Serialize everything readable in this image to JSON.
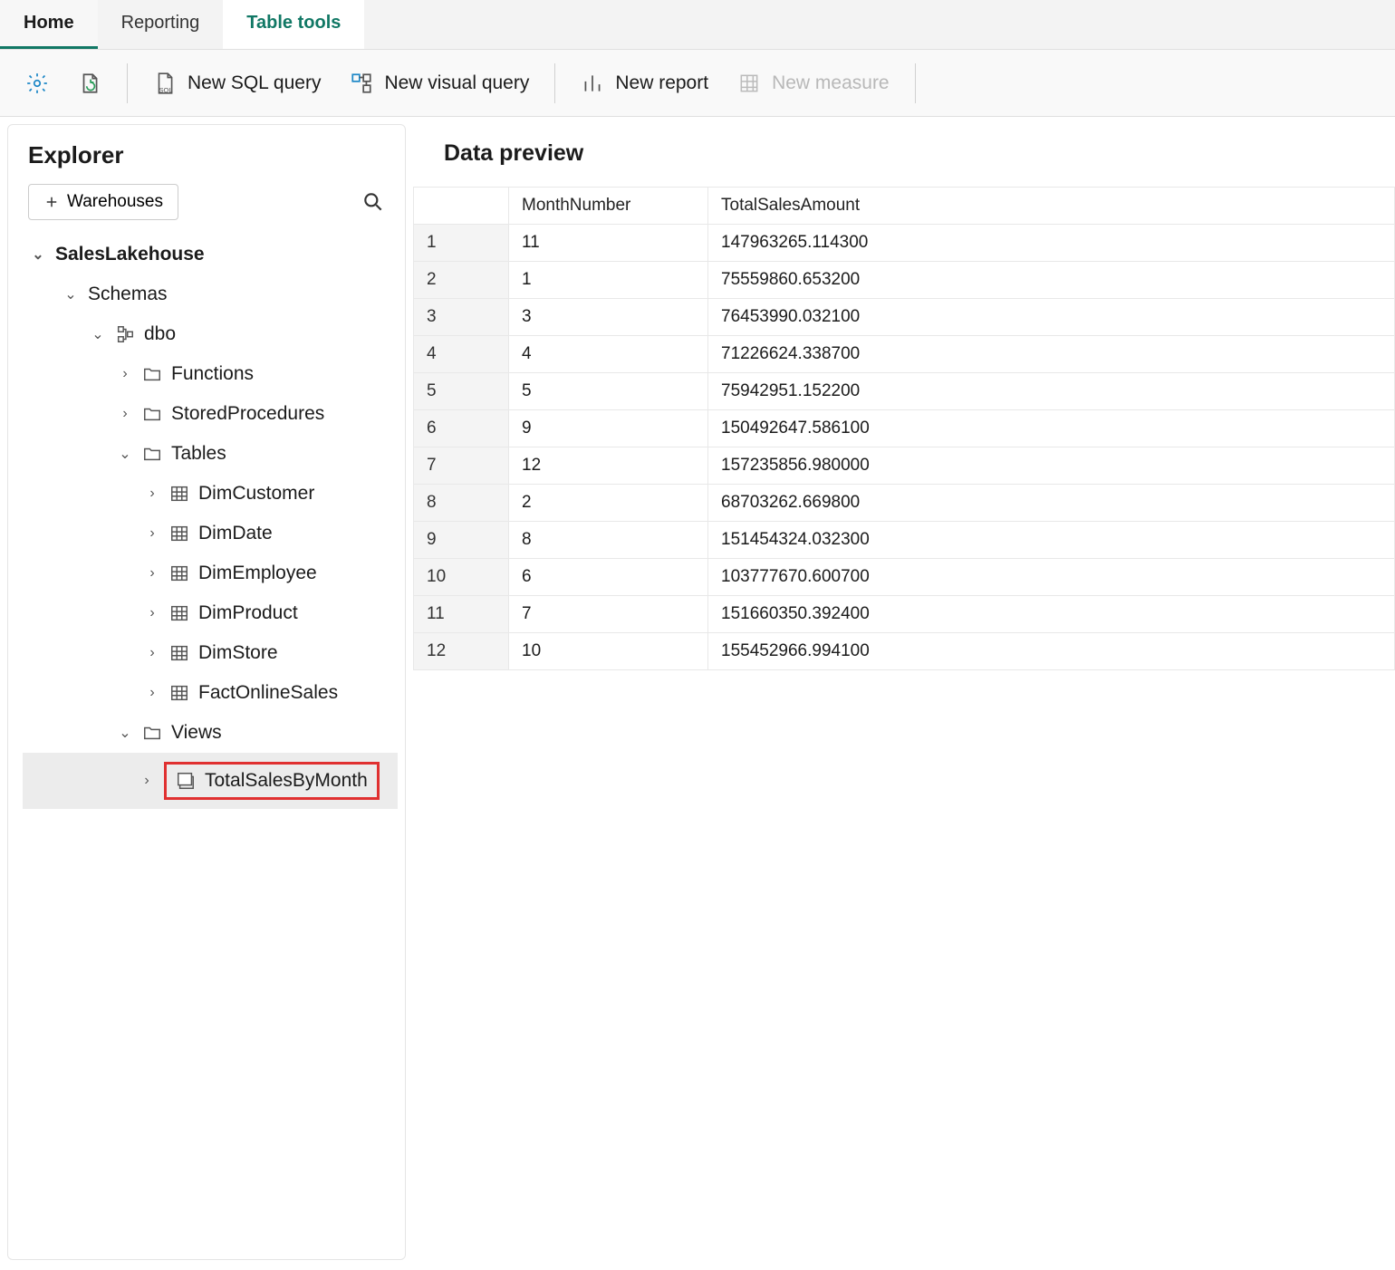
{
  "tabs": {
    "home": "Home",
    "reporting": "Reporting",
    "tableTools": "Table tools"
  },
  "toolbar": {
    "newSql": "New SQL query",
    "newVisual": "New visual query",
    "newReport": "New report",
    "newMeasure": "New measure"
  },
  "explorer": {
    "title": "Explorer",
    "warehousesBtn": "Warehouses",
    "root": "SalesLakehouse",
    "schemas": "Schemas",
    "dbo": "dbo",
    "functions": "Functions",
    "storedProcedures": "StoredProcedures",
    "tablesLabel": "Tables",
    "tables": {
      "dimCustomer": "DimCustomer",
      "dimDate": "DimDate",
      "dimEmployee": "DimEmployee",
      "dimProduct": "DimProduct",
      "dimStore": "DimStore",
      "factOnlineSales": "FactOnlineSales"
    },
    "viewsLabel": "Views",
    "views": {
      "totalSalesByMonth": "TotalSalesByMonth"
    }
  },
  "preview": {
    "title": "Data preview",
    "columns": {
      "idx": "",
      "monthNumber": "MonthNumber",
      "totalSalesAmount": "TotalSalesAmount"
    },
    "rows": [
      {
        "i": "1",
        "m": "11",
        "t": "147963265.114300"
      },
      {
        "i": "2",
        "m": "1",
        "t": "75559860.653200"
      },
      {
        "i": "3",
        "m": "3",
        "t": "76453990.032100"
      },
      {
        "i": "4",
        "m": "4",
        "t": "71226624.338700"
      },
      {
        "i": "5",
        "m": "5",
        "t": "75942951.152200"
      },
      {
        "i": "6",
        "m": "9",
        "t": "150492647.586100"
      },
      {
        "i": "7",
        "m": "12",
        "t": "157235856.980000"
      },
      {
        "i": "8",
        "m": "2",
        "t": "68703262.669800"
      },
      {
        "i": "9",
        "m": "8",
        "t": "151454324.032300"
      },
      {
        "i": "10",
        "m": "6",
        "t": "103777670.600700"
      },
      {
        "i": "11",
        "m": "7",
        "t": "151660350.392400"
      },
      {
        "i": "12",
        "m": "10",
        "t": "155452966.994100"
      }
    ]
  }
}
